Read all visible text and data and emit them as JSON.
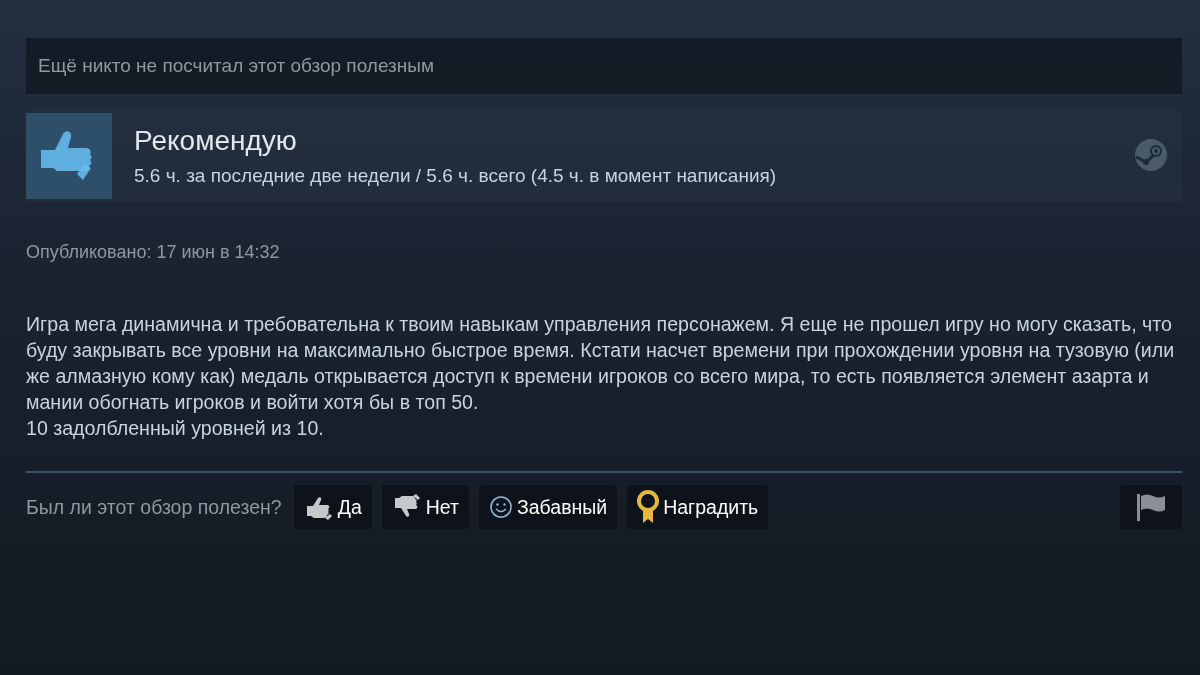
{
  "helpful_summary": "Ещё никто не посчитал этот обзор полезным",
  "review_header": {
    "verdict": "Рекомендую",
    "recommended": true,
    "playtime": "5.6 ч. за последние две недели / 5.6 ч. всего (4.5 ч. в момент написания)"
  },
  "posted": "Опубликовано: 17 июн в 14:32",
  "review_paragraphs": [
    "Игра мега динамична и требовательна к твоим навыкам управления персонажем. Я еще не прошел игру но могу сказать, что буду закрывать все уровни на максимально быстрое время. Кстати насчет времени при прохождении уровня на тузовую (или же алмазную кому как) медаль открывается доступ к времени игроков со всего мира, то есть появляется элемент азарта и мании обогнать игроков и войти хотя бы в топ 50.",
    "10 задолбленный уровней из 10."
  ],
  "feedback": {
    "question": "Был ли этот обзор полезен?",
    "buttons": [
      {
        "kind": "thumbs_up",
        "label": "Да"
      },
      {
        "kind": "thumbs_down",
        "label": "Нет"
      },
      {
        "kind": "smiley",
        "label": "Забавный"
      },
      {
        "kind": "award",
        "label": "Наградить"
      }
    ]
  }
}
